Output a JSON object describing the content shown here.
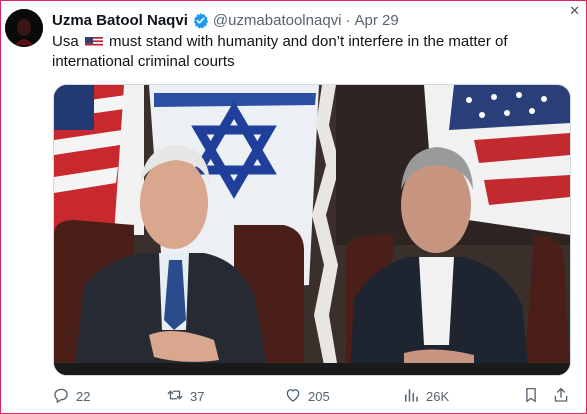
{
  "post": {
    "author_name": "Uzma Batool Naqvi",
    "handle": "@uzmabatoolnaqvi",
    "separator": "·",
    "date": "Apr 29",
    "text_before_flag": "Usa",
    "flag_icon": "us-flag-emoji",
    "text_after_flag": "must stand with humanity and don’t interfere in the matter of international criminal courts"
  },
  "window": {
    "close_glyph": "✕"
  },
  "actions": {
    "replies": "22",
    "reposts": "37",
    "likes": "205",
    "views": "26K"
  },
  "icons": {
    "reply": "reply-icon",
    "repost": "repost-icon",
    "like": "like-icon",
    "views": "views-icon",
    "bookmark": "bookmark-icon",
    "share": "share-icon",
    "verified": "verified-badge-icon"
  },
  "colors": {
    "accent": "#1d9bf0",
    "muted": "#536471",
    "frame_border": "#e0245e"
  }
}
